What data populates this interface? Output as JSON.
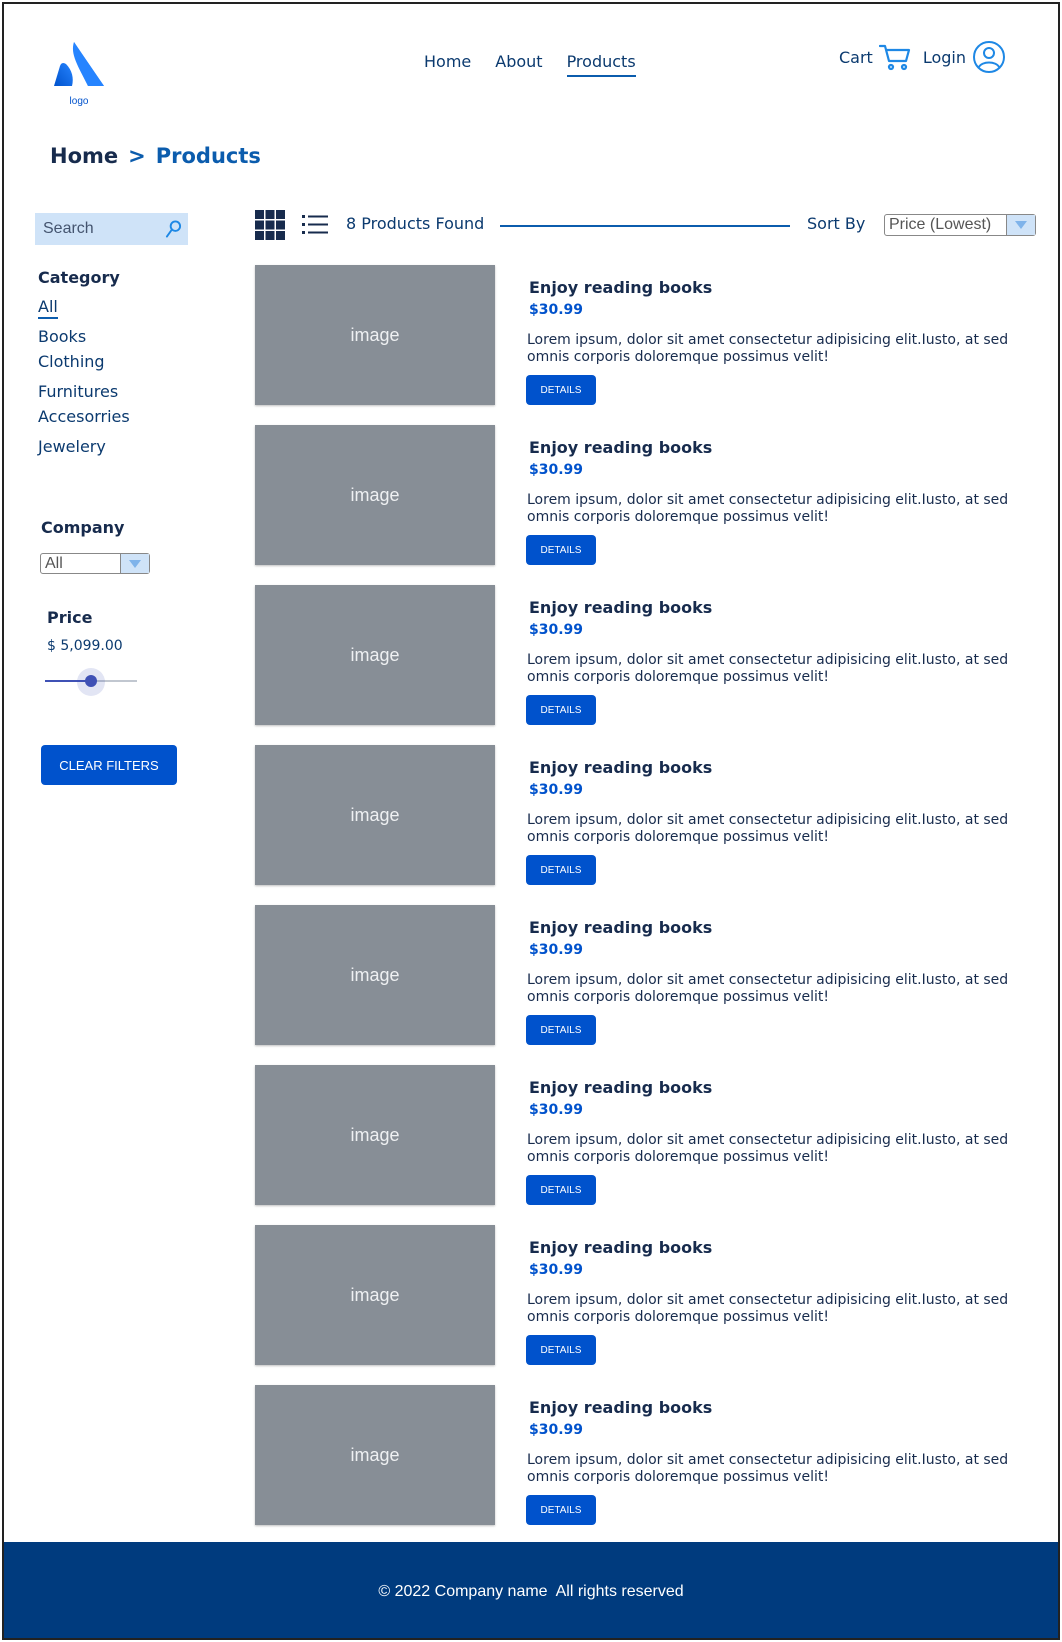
{
  "header": {
    "logo_text": "logo",
    "nav": [
      {
        "label": "Home"
      },
      {
        "label": "About"
      },
      {
        "label": "Products"
      }
    ],
    "cart_label": "Cart",
    "login_label": "Login"
  },
  "breadcrumb": {
    "home": "Home",
    "separator": ">",
    "current": "Products"
  },
  "sidebar": {
    "search_placeholder": "Search",
    "category_heading": "Category",
    "categories": [
      {
        "label": "All"
      },
      {
        "label": "Books"
      },
      {
        "label": "Clothing"
      },
      {
        "label": "Furnitures"
      },
      {
        "label": "Accesorries"
      },
      {
        "label": "Jewelery"
      }
    ],
    "company_heading": "Company",
    "company_selected": "All",
    "price_heading": "Price",
    "price_value": "$ 5,099.00",
    "price_slider_fraction": 0.5,
    "clear_filters_label": "CLEAR FILTERS"
  },
  "toolbar": {
    "products_found": "8 Products Found",
    "sort_label": "Sort By",
    "sort_selected": "Price (Lowest)"
  },
  "products": [
    {
      "image_label": "image",
      "title": "Enjoy reading books",
      "price": "$30.99",
      "description": "Lorem ipsum, dolor sit amet consectetur adipisicing elit.Iusto, at sed omnis corporis doloremque possimus velit!",
      "button": "DETAILS"
    },
    {
      "image_label": "image",
      "title": "Enjoy reading books",
      "price": "$30.99",
      "description": "Lorem ipsum, dolor sit amet consectetur adipisicing elit.Iusto, at sed omnis corporis doloremque possimus velit!",
      "button": "DETAILS"
    },
    {
      "image_label": "image",
      "title": "Enjoy reading books",
      "price": "$30.99",
      "description": "Lorem ipsum, dolor sit amet consectetur adipisicing elit.Iusto, at sed omnis corporis doloremque possimus velit!",
      "button": "DETAILS"
    },
    {
      "image_label": "image",
      "title": "Enjoy reading books",
      "price": "$30.99",
      "description": "Lorem ipsum, dolor sit amet consectetur adipisicing elit.Iusto, at sed omnis corporis doloremque possimus velit!",
      "button": "DETAILS"
    },
    {
      "image_label": "image",
      "title": "Enjoy reading books",
      "price": "$30.99",
      "description": "Lorem ipsum, dolor sit amet consectetur adipisicing elit.Iusto, at sed omnis corporis doloremque possimus velit!",
      "button": "DETAILS"
    },
    {
      "image_label": "image",
      "title": "Enjoy reading books",
      "price": "$30.99",
      "description": "Lorem ipsum, dolor sit amet consectetur adipisicing elit.Iusto, at sed omnis corporis doloremque possimus velit!",
      "button": "DETAILS"
    },
    {
      "image_label": "image",
      "title": "Enjoy reading books",
      "price": "$30.99",
      "description": "Lorem ipsum, dolor sit amet consectetur adipisicing elit.Iusto, at sed omnis corporis doloremque possimus velit!",
      "button": "DETAILS"
    },
    {
      "image_label": "image",
      "title": "Enjoy reading books",
      "price": "$30.99",
      "description": "Lorem ipsum, dolor sit amet consectetur adipisicing elit.Iusto, at sed omnis corporis doloremque possimus velit!",
      "button": "DETAILS"
    }
  ],
  "footer": {
    "text": "© 2022 Company name  All rights reserved"
  },
  "colors": {
    "brand": "#0052cc",
    "nav_text": "#0b3a6f",
    "footer_bg": "#003b7e",
    "image_placeholder": "#878e96",
    "search_bg": "#cfe3f8"
  },
  "icons": {
    "grid_view": "grid-view-icon",
    "list_view": "list-view-icon",
    "cart": "cart-icon",
    "user": "user-icon",
    "search": "search-icon",
    "dropdown": "chevron-down-icon"
  }
}
